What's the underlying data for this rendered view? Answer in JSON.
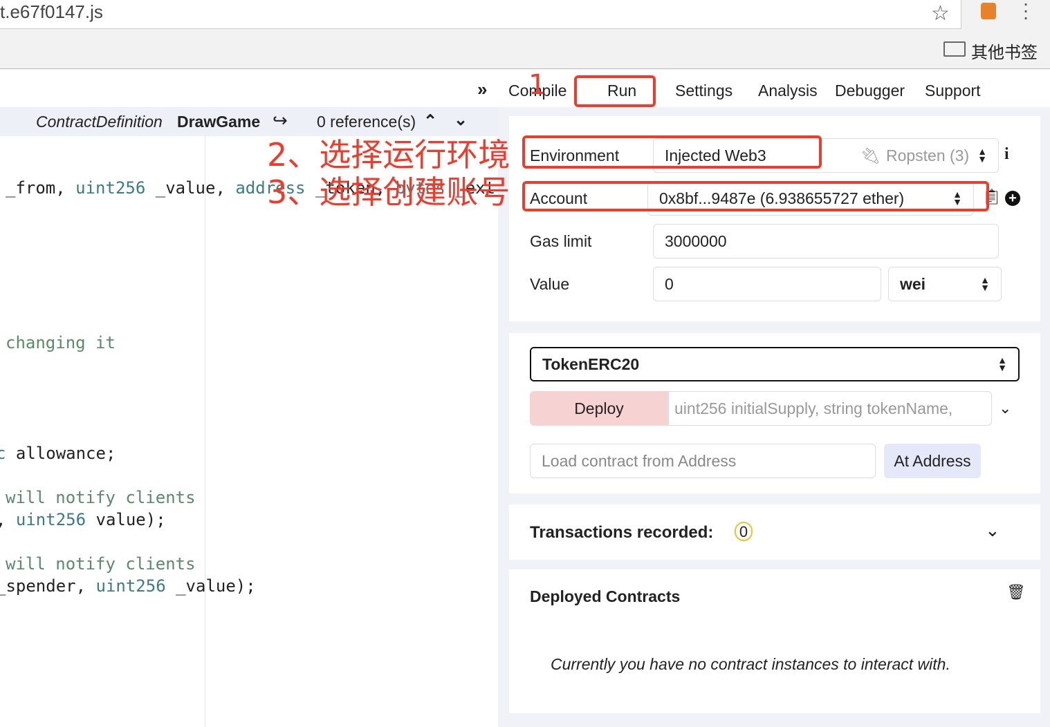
{
  "browser": {
    "url_fragment": "t.e67f0147.js",
    "bookmark_folder": "其他书签"
  },
  "editor": {
    "header": {
      "kind": "ContractDefinition",
      "name": "DrawGame",
      "references": "0 reference(s)"
    },
    "lines": [
      {
        "parts": [
          [
            "_from, ",
            "n"
          ],
          [
            "uint256",
            "k"
          ],
          [
            " _value, ",
            "n"
          ],
          [
            "address",
            "k"
          ],
          [
            " _token, ",
            "n"
          ],
          [
            "bytes",
            "k"
          ],
          [
            " _extr",
            "n"
          ]
        ]
      },
      {
        "parts": [
          [
            "changing it",
            "c"
          ]
        ]
      },
      {
        "parts": [
          [
            "c",
            "k"
          ],
          [
            " allowance;",
            "n"
          ]
        ]
      },
      {
        "parts": [
          [
            "will notify clients",
            "c"
          ]
        ]
      },
      {
        "parts": [
          [
            ", ",
            "n"
          ],
          [
            "uint256",
            "k"
          ],
          [
            " value);",
            "n"
          ]
        ]
      },
      {
        "parts": [
          [
            "will notify clients",
            "c"
          ]
        ]
      },
      {
        "parts": [
          [
            "_spender, ",
            "n"
          ],
          [
            "uint256",
            "k"
          ],
          [
            " _value);",
            "n"
          ]
        ]
      }
    ]
  },
  "tabs": [
    "Compile",
    "Run",
    "Settings",
    "Analysis",
    "Debugger",
    "Support"
  ],
  "annotations": {
    "step1": "1",
    "step2": "2、选择运行环境",
    "step3": "3、选择创建账号"
  },
  "run": {
    "environment_label": "Environment",
    "environment_value": "Injected Web3",
    "network": "Ropsten (3)",
    "account_label": "Account",
    "account_value": "0x8bf...9487e (6.938655727 ether)",
    "gas_label": "Gas limit",
    "gas_value": "3000000",
    "value_label": "Value",
    "value_value": "0",
    "value_unit": "wei",
    "contract": "TokenERC20",
    "deploy": "Deploy",
    "deploy_placeholder": "uint256 initialSupply, string tokenName,",
    "load_placeholder": "Load contract from Address",
    "at_address": "At Address",
    "tx_label": "Transactions recorded:",
    "tx_count": "0",
    "deployed_title": "Deployed Contracts",
    "deployed_empty": "Currently you have no contract instances to interact with."
  },
  "colors": {
    "annotation": "#f03a2a",
    "deploy_bg": "#f6d2d2",
    "at_address_bg": "#e4e8f8"
  }
}
